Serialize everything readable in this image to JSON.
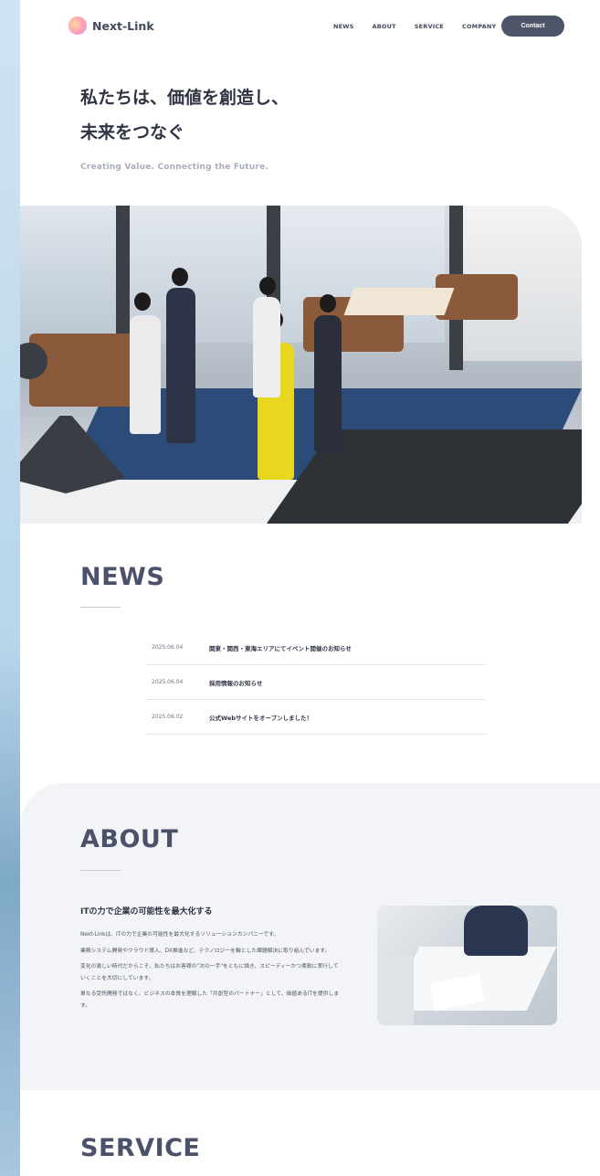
{
  "header": {
    "logo_text": "Next-Link",
    "nav": [
      "NEWS",
      "ABOUT",
      "SERVICE",
      "COMPANY"
    ],
    "contact_label": "Contact"
  },
  "hero": {
    "title_line1": "私たちは、価値を創造し、",
    "title_line2": "未来をつなぐ",
    "subtitle": "Creating Value. Connecting the Future."
  },
  "news": {
    "title": "NEWS",
    "items": [
      {
        "date": "2025.06.04",
        "text": "関東・関西・東海エリアにてイベント開催のお知らせ"
      },
      {
        "date": "2025.06.04",
        "text": "採用情報のお知らせ"
      },
      {
        "date": "2025.06.02",
        "text": "公式Webサイトをオープンしました！"
      }
    ]
  },
  "about": {
    "title": "ABOUT",
    "heading": "ITの力で企業の可能性を最大化する",
    "paragraphs": [
      "Next-Linkは、ITの力で企業の可能性を最大化するソリューションカンパニーです。",
      "業務システム開発やクラウド導入、DX推進など、テクノロジーを軸とした課題解決に取り組んでいます。",
      "変化の激しい時代だからこそ、私たちはお客様の\"次の一手\"をともに描き、スピーディーかつ柔軟に実行していくことを大切にしています。",
      "単なる受託開発ではなく、ビジネスの本質を理解した「共創型のパートナー」として、価値あるITを提供します。"
    ]
  },
  "service": {
    "title": "SERVICE"
  }
}
